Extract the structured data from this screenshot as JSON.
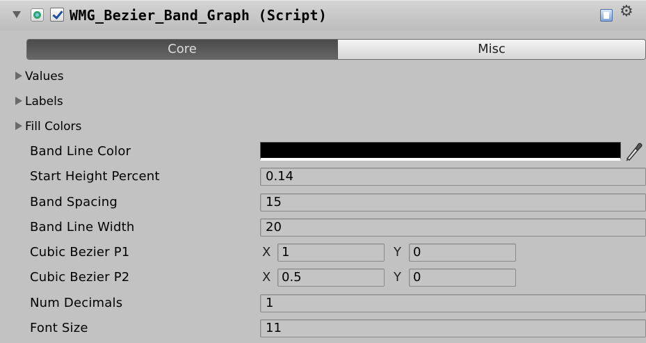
{
  "header": {
    "title": "WMG_Bezier_Band_Graph (Script)",
    "enabled": true
  },
  "tabs": [
    {
      "label": "Core",
      "selected": true
    },
    {
      "label": "Misc",
      "selected": false
    }
  ],
  "foldouts": [
    {
      "label": "Values"
    },
    {
      "label": "Labels"
    },
    {
      "label": "Fill Colors"
    }
  ],
  "properties": {
    "band_line_color": {
      "label": "Band Line Color",
      "color": "#000000"
    },
    "start_height_percent": {
      "label": "Start Height Percent",
      "value": "0.14"
    },
    "band_spacing": {
      "label": "Band Spacing",
      "value": "15"
    },
    "band_line_width": {
      "label": "Band Line Width",
      "value": "20"
    },
    "cubic_bezier_p1": {
      "label": "Cubic Bezier P1",
      "x_label": "X",
      "x": "1",
      "y_label": "Y",
      "y": "0"
    },
    "cubic_bezier_p2": {
      "label": "Cubic Bezier P2",
      "x_label": "X",
      "x": "0.5",
      "y_label": "Y",
      "y": "0"
    },
    "num_decimals": {
      "label": "Num Decimals",
      "value": "1"
    },
    "font_size": {
      "label": "Font Size",
      "value": "11"
    }
  },
  "icons": {
    "fold": "fold-arrow-icon",
    "script": "script-icon",
    "help": "help-icon",
    "settings": "gear-icon",
    "picker": "eyedropper-icon"
  }
}
